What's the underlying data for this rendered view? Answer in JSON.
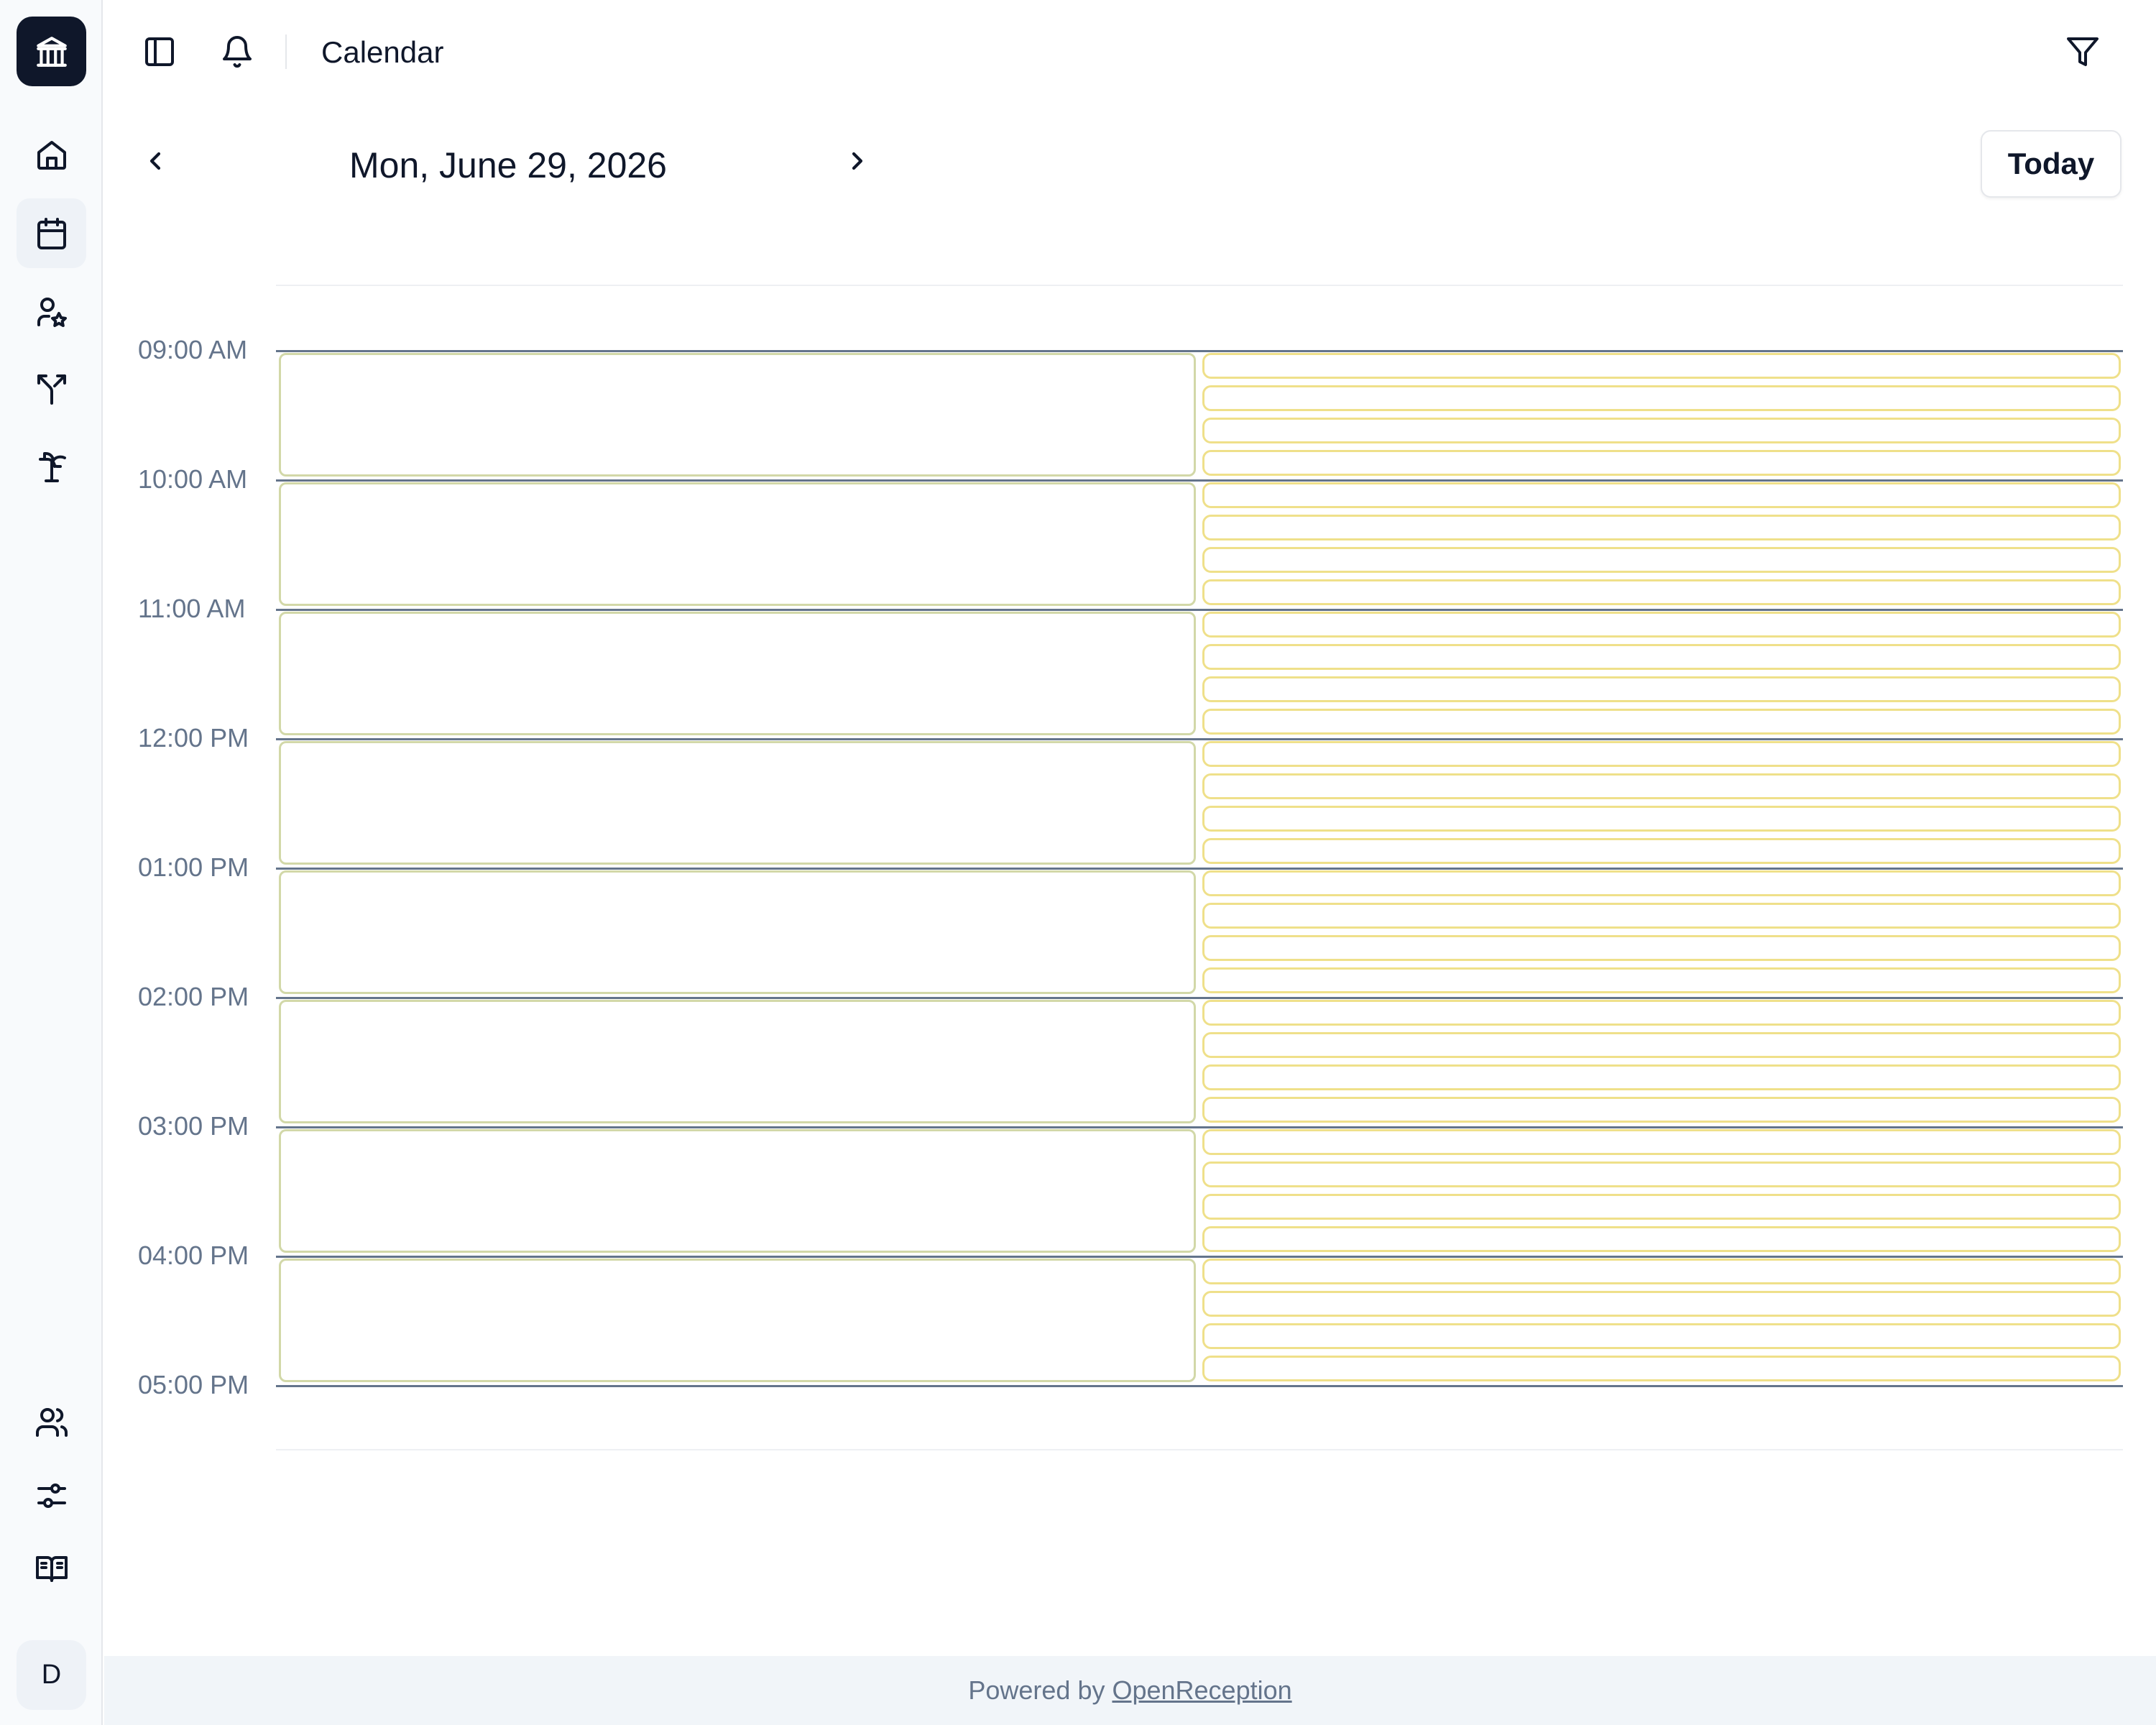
{
  "app": {
    "title": "Calendar",
    "user_initial": "D"
  },
  "sidebar": {
    "logo_icon": "bank-building-icon",
    "items": [
      {
        "name": "home",
        "icon": "home-icon",
        "active": false
      },
      {
        "name": "calendar",
        "icon": "calendar-icon",
        "active": true
      },
      {
        "name": "staff",
        "icon": "user-star-icon",
        "active": false
      },
      {
        "name": "routing",
        "icon": "split-arrows-icon",
        "active": false
      },
      {
        "name": "holidays",
        "icon": "palm-tree-icon",
        "active": false
      }
    ],
    "bottom_items": [
      {
        "name": "users",
        "icon": "users-icon"
      },
      {
        "name": "settings",
        "icon": "sliders-icon"
      },
      {
        "name": "docs",
        "icon": "book-open-icon"
      }
    ]
  },
  "header": {
    "toggle_sidebar_icon": "panel-left-icon",
    "notifications_icon": "bell-icon",
    "filter_icon": "filter-icon"
  },
  "date_nav": {
    "date": "Mon, June 29, 2026",
    "today_label": "Today",
    "prev_icon": "chevron-left-icon",
    "next_icon": "chevron-right-icon"
  },
  "calendar": {
    "hours": [
      "09:00 AM",
      "10:00 AM",
      "11:00 AM",
      "12:00 PM",
      "01:00 PM",
      "02:00 PM",
      "03:00 PM",
      "04:00 PM",
      "05:00 PM"
    ],
    "small_slots_per_hour": 4,
    "colors": {
      "hour_slot_border": "#d2d8a8",
      "quarter_slot_border": "#efe08a",
      "hour_line": "#64748b"
    }
  },
  "footer": {
    "prefix": "Powered by",
    "link_text": "OpenReception"
  }
}
